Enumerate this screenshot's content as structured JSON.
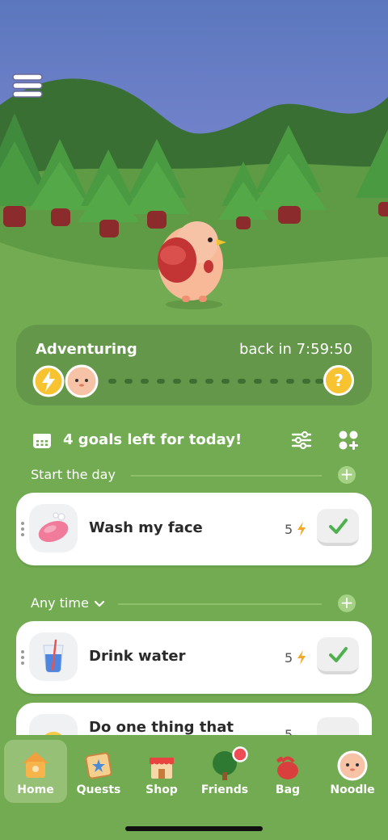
{
  "adventure": {
    "title": "Adventuring",
    "timer": "back in 7:59:50",
    "mystery_symbol": "?",
    "icons": [
      "lightning-icon",
      "noodle-face-icon",
      "question-icon"
    ]
  },
  "goals": {
    "count_text": "4 goals left for today!",
    "sections": [
      {
        "label": "Start the day",
        "add_symbol": "+",
        "items": [
          {
            "title": "Wash my face",
            "points": "5",
            "icon": "soap-icon"
          }
        ]
      },
      {
        "label": "Any time",
        "add_symbol": "+",
        "items": [
          {
            "title": "Drink water",
            "points": "5",
            "icon": "water-glass-icon"
          },
          {
            "title": "Do one thing that",
            "points": "5",
            "icon": "smiley-icon"
          }
        ]
      }
    ]
  },
  "tabs": [
    {
      "label": "Home",
      "icon": "home-icon",
      "active": true
    },
    {
      "label": "Quests",
      "icon": "quests-icon"
    },
    {
      "label": "Shop",
      "icon": "shop-icon"
    },
    {
      "label": "Friends",
      "icon": "friends-tree-icon",
      "badge": true
    },
    {
      "label": "Bag",
      "icon": "bag-icon"
    },
    {
      "label": "Noodle",
      "icon": "noodle-icon"
    }
  ],
  "colors": {
    "sky_top": "#5b77bd",
    "sky_bottom": "#8f90dc",
    "grass": "#72ab52",
    "accent_green": "#4fb04f",
    "energy_yellow": "#f8c331"
  }
}
